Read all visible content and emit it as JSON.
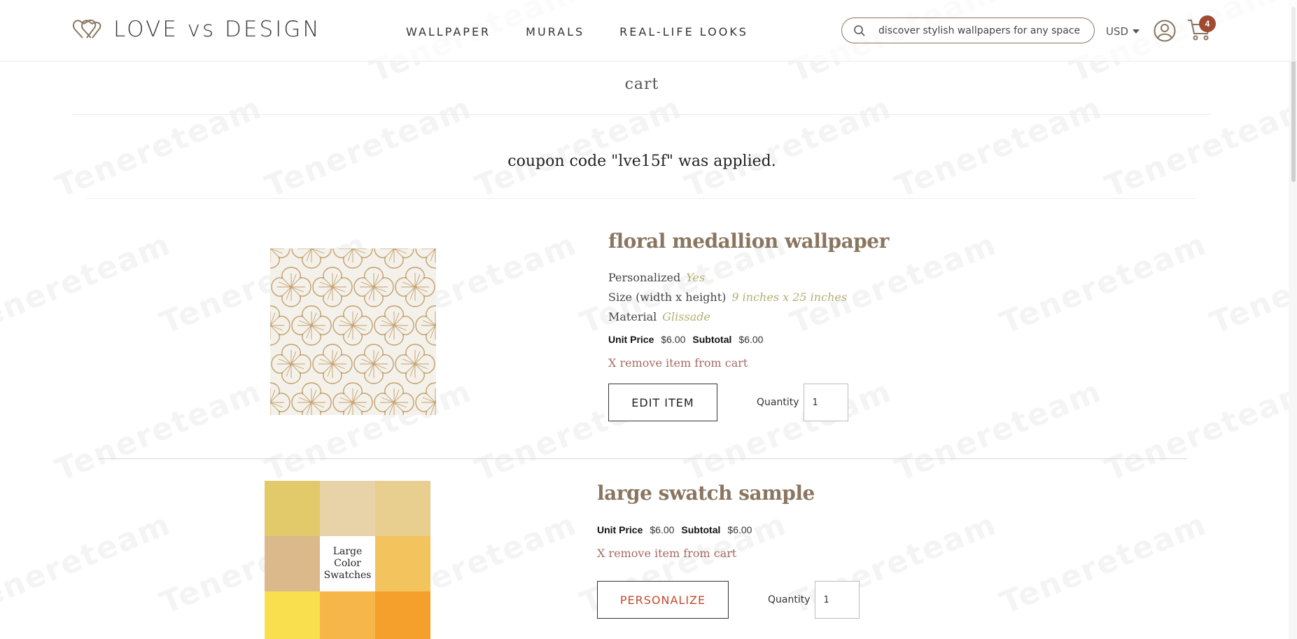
{
  "header": {
    "logo_text": "LOVE vs DESIGN",
    "nav": [
      "WALLPAPER",
      "MURALS",
      "REAL-LIFE LOOKS"
    ],
    "search_placeholder": "discover stylish wallpapers for any space!",
    "currency": "USD",
    "cart_count": "4"
  },
  "page": {
    "title": "cart",
    "coupon_message": "coupon code \"lve15f\" was applied."
  },
  "items": [
    {
      "title": "floral medallion wallpaper",
      "attributes": [
        {
          "label": "Personalized",
          "value": "Yes"
        },
        {
          "label": "Size (width x height)",
          "value": "9 inches x 25 inches"
        },
        {
          "label": "Material",
          "value": "Glissade"
        }
      ],
      "unit_price_label": "Unit Price",
      "unit_price": "$6.00",
      "subtotal_label": "Subtotal",
      "subtotal": "$6.00",
      "remove_label": "X remove item from cart",
      "action_label": "EDIT ITEM",
      "quantity_label": "Quantity",
      "quantity": "1"
    },
    {
      "title": "large swatch sample",
      "swatch_label": "Large Color Swatches",
      "unit_price_label": "Unit Price",
      "unit_price": "$6.00",
      "subtotal_label": "Subtotal",
      "subtotal": "$6.00",
      "remove_label": "X remove item from cart",
      "action_label": "PERSONALIZE",
      "quantity_label": "Quantity",
      "quantity": "1"
    }
  ],
  "watermark": "Tenereteam",
  "colors": {
    "accent_brown": "#8a7660",
    "attr_value": "#b3ae72",
    "remove_link": "#a56b64",
    "cart_badge": "#a04a34",
    "personalize": "#c24a2c",
    "swatches": [
      "#e2c96a",
      "#e8d2a8",
      "#e8cf8f",
      "#dbb98a",
      "#ffffff",
      "#f3c35e",
      "#f9de4e",
      "#f7b64a",
      "#f5a02c"
    ]
  }
}
